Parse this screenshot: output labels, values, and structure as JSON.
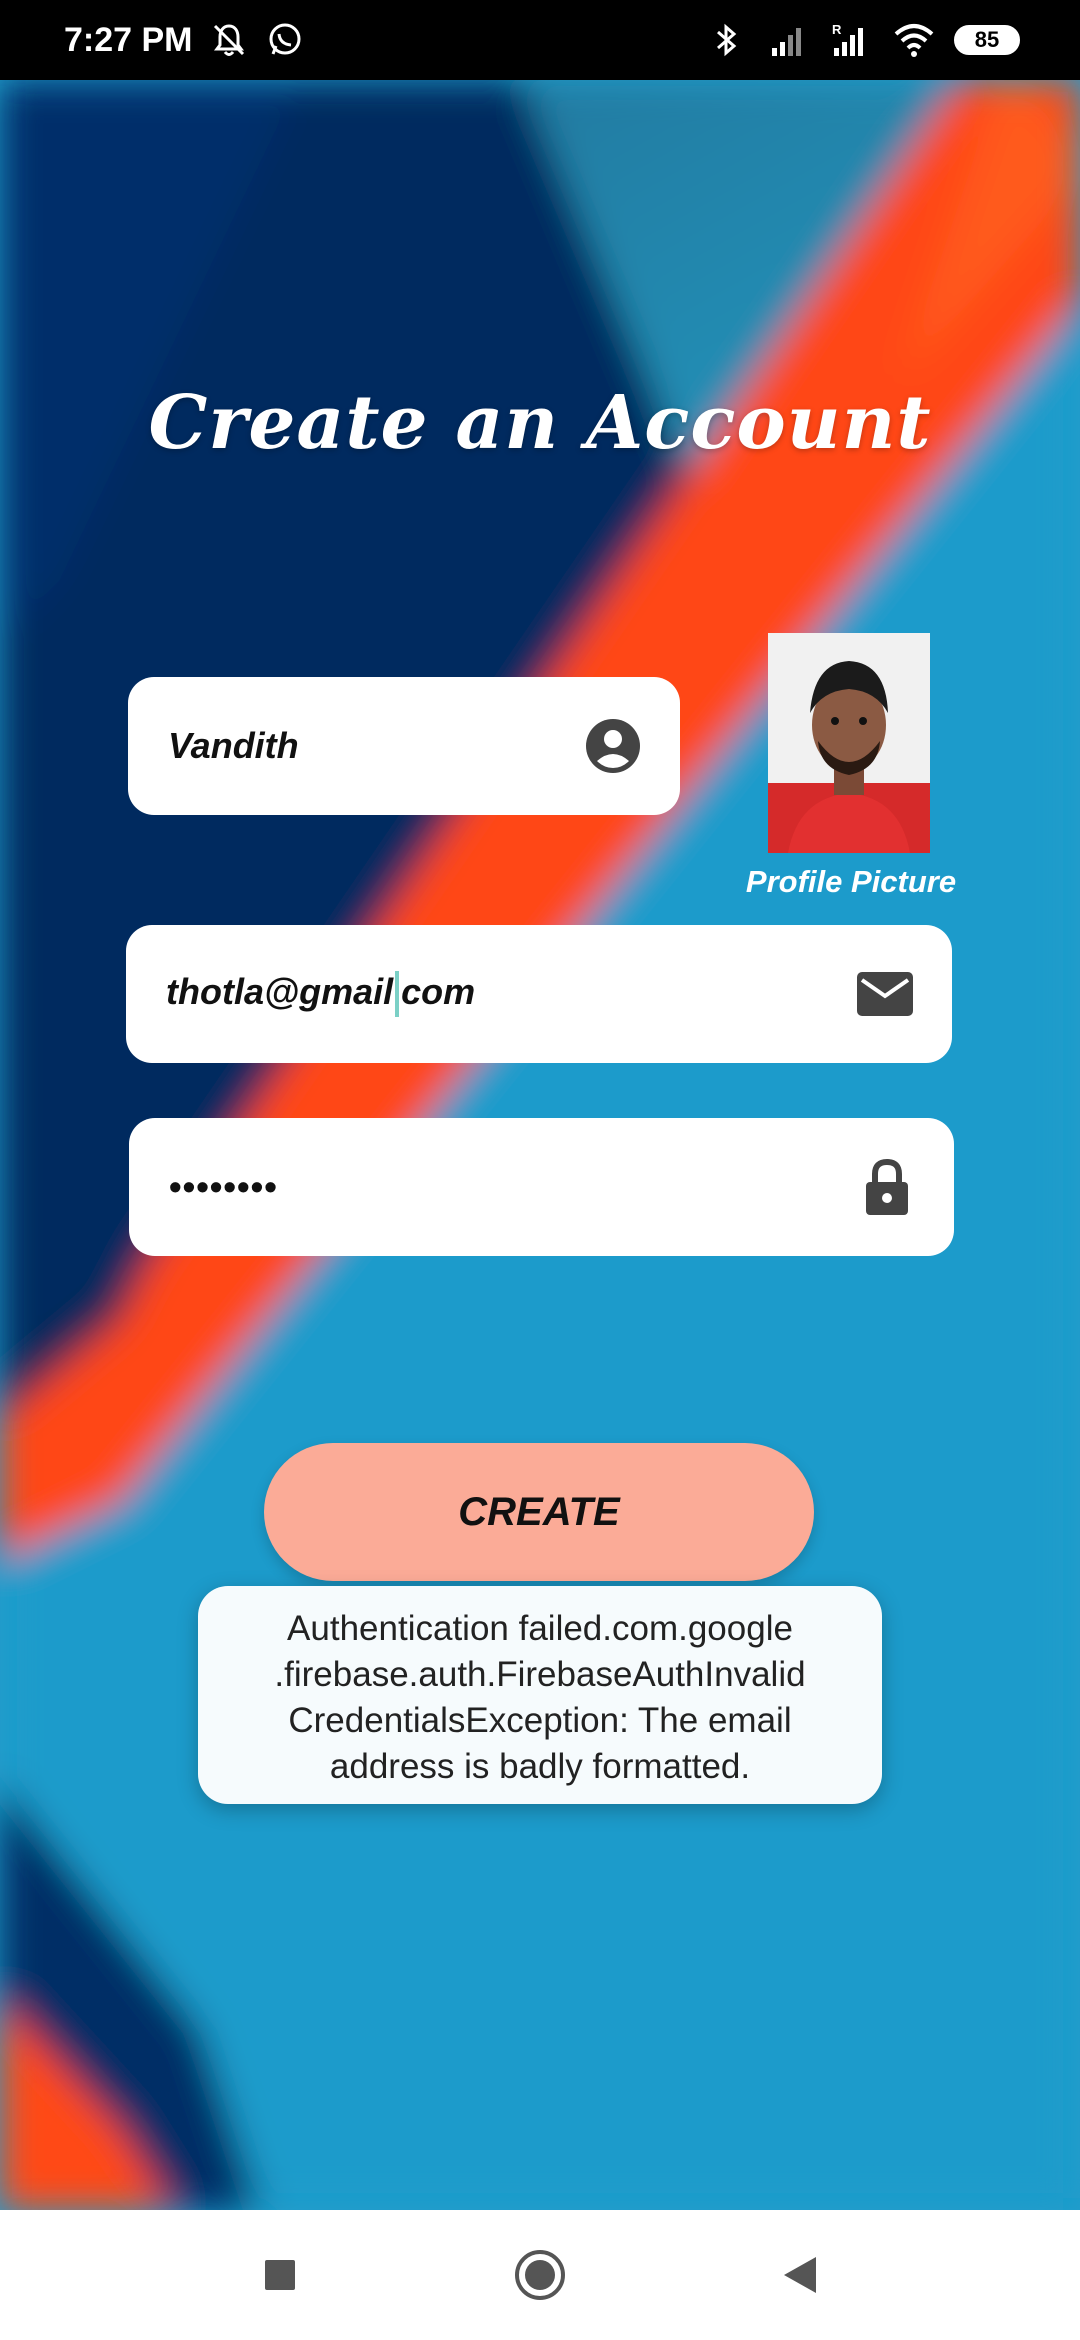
{
  "status_bar": {
    "time": "7:27 PM",
    "icons": [
      "bell-off-icon",
      "whatsapp-icon"
    ],
    "right_icons": [
      "bluetooth-icon",
      "signal-icon",
      "signal-roaming-icon",
      "wifi-icon"
    ],
    "battery_level": "85"
  },
  "title": "Create an Account",
  "name_field": {
    "value": "Vandith",
    "icon": "account-circle-icon"
  },
  "profile": {
    "label": "Profile Picture"
  },
  "email_field": {
    "value_before": "thotla@gmail",
    "value_after": "com",
    "icon": "email-icon"
  },
  "password_field": {
    "value": "••••••••",
    "icon": "lock-icon"
  },
  "create_button": {
    "label": "CREATE"
  },
  "toast": {
    "lines": [
      "Authentication failed.com.google",
      ".firebase.auth.FirebaseAuthInvalid",
      "CredentialsException: The email",
      "address is badly formatted."
    ]
  },
  "nav_bar": {
    "buttons": [
      "recents-button",
      "home-button",
      "back-button"
    ]
  },
  "colors": {
    "background_blue": "#1f98c9",
    "orange_stripe": "#ff4a12",
    "dark_navy": "#062a66",
    "create_button": "#fbab97",
    "field_background": "#ffffff"
  }
}
